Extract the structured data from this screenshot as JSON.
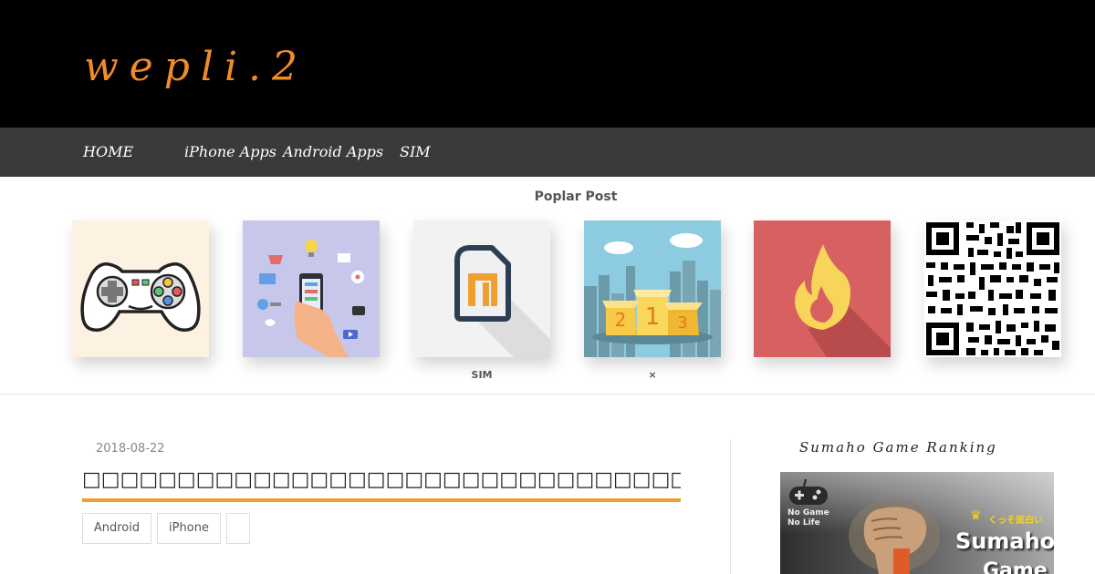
{
  "site": {
    "logo": "wepli.2",
    "colors": {
      "header_bg": "#000000",
      "nav_bg": "#3a3a3a",
      "logo": "#f08c28",
      "title_underline": "#f0a030"
    }
  },
  "nav": {
    "items": [
      {
        "label": "HOME"
      },
      {
        "label": "iPhone Apps"
      },
      {
        "label": "Android Apps"
      },
      {
        "label": "SIM"
      }
    ]
  },
  "popular": {
    "title": "Poplar Post",
    "posts": [
      {
        "icon": "game-controller-icon",
        "caption": ""
      },
      {
        "icon": "smartphone-apps-icon",
        "caption": ""
      },
      {
        "icon": "sim-card-icon",
        "caption": "SIM"
      },
      {
        "icon": "ranking-podium-icon",
        "caption": "×"
      },
      {
        "icon": "fire-icon",
        "caption": ""
      },
      {
        "icon": "qr-code-icon",
        "caption": ""
      }
    ]
  },
  "article": {
    "date": "2018-08-22",
    "title": "□□□□□□□□□□□□□□□□□□□□□□□□□□□□□□□□□□□□□□□□□□□□□",
    "tags": [
      "Android",
      "iPhone",
      ""
    ]
  },
  "sidebar": {
    "title": "Sumaho Game Ranking",
    "banner": {
      "line1": "No Game",
      "line2": "No Life",
      "jp": "くっそ面白い",
      "big1": "Sumaho",
      "big2": "Game",
      "icon": "gamepad-icon"
    }
  }
}
